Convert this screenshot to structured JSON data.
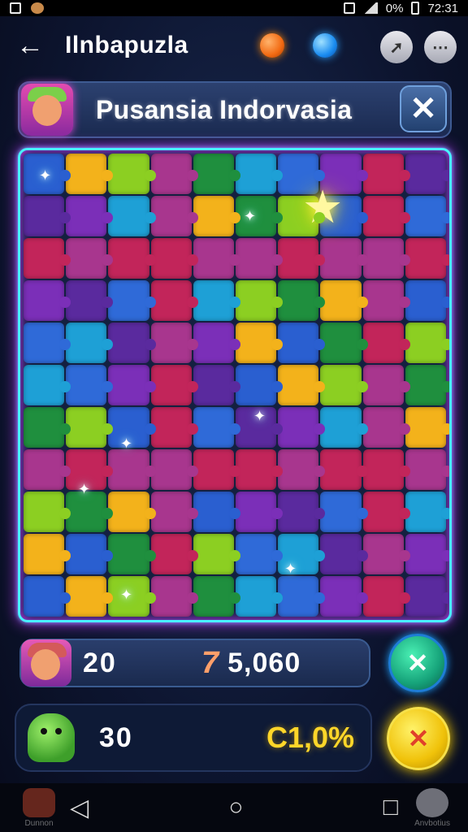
{
  "status_bar": {
    "time": "72:31",
    "battery": "0%"
  },
  "header": {
    "back_icon": "arrow-left-icon",
    "title": "Ilnbapuzla"
  },
  "banner": {
    "title": "Pusansia Indorvasia",
    "close_label": "✕"
  },
  "board": {
    "columns": 10,
    "rows": 11,
    "palette": [
      "#2a5fd0",
      "#7b2fb8",
      "#1f8f3e",
      "#f3b21b",
      "#c2255a",
      "#1ea0d6",
      "#8ccf22",
      "#5a2a9e",
      "#2f6ad8",
      "#a8368e"
    ]
  },
  "player_row": {
    "level": "20",
    "score_icon": "7",
    "score": "5,060",
    "button_label": "✕"
  },
  "monster_row": {
    "level": "30",
    "percent": "C1,0%",
    "button_label": "✕"
  },
  "nav": {
    "left_label": "Dunnon",
    "right_label": "Anvbotius",
    "back": "◁",
    "home": "○",
    "recent": "□"
  }
}
